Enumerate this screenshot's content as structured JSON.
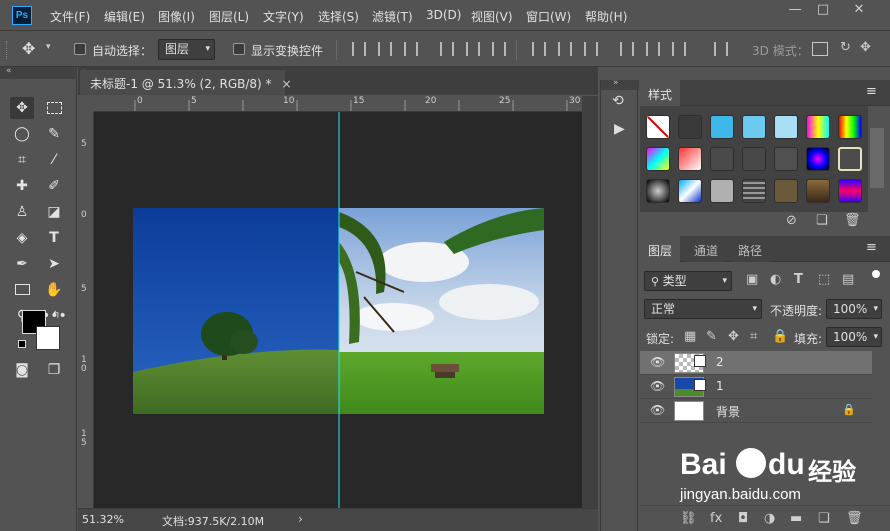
{
  "app": {
    "logo": "Ps"
  },
  "menu": [
    "文件(F)",
    "编辑(E)",
    "图像(I)",
    "图层(L)",
    "文字(Y)",
    "选择(S)",
    "滤镜(T)",
    "3D(D)",
    "视图(V)",
    "窗口(W)",
    "帮助(H)"
  ],
  "window_controls": {
    "minimize": "—",
    "maximize": "□",
    "close": "✕"
  },
  "options": {
    "auto_select_label": "自动选择：",
    "auto_select_value": "图层",
    "show_transform_label": "显示变换控件",
    "mode_3d_label": "3D 模式："
  },
  "document": {
    "tab_title": "未标题-1 @ 51.3% (2, RGB/8) *",
    "tab_close": "×"
  },
  "ruler": {
    "top": [
      "0",
      "5",
      "10",
      "15",
      "20",
      "25",
      "30"
    ],
    "left": [
      "5",
      "0",
      "5",
      "1\n0",
      "1\n5"
    ]
  },
  "status": {
    "zoom": "51.32%",
    "doc_info": "文档:937.5K/2.10M",
    "arrow": "›"
  },
  "styles_panel": {
    "title": "样式"
  },
  "layers_panel": {
    "tabs": [
      "图层",
      "通道",
      "路径"
    ],
    "filter_label": "类型",
    "blend_mode": "正常",
    "opacity_label": "不透明度:",
    "opacity_value": "100%",
    "lock_label": "锁定:",
    "fill_label": "填充:",
    "fill_value": "100%",
    "layers": [
      {
        "name": "2",
        "selected": true
      },
      {
        "name": "1",
        "selected": false
      },
      {
        "name": "背景",
        "selected": false,
        "locked": true
      }
    ]
  },
  "watermark": {
    "brand": "Bai",
    "brand2": "du",
    "jingyan": "经验",
    "url": "jingyan.baidu.com"
  }
}
